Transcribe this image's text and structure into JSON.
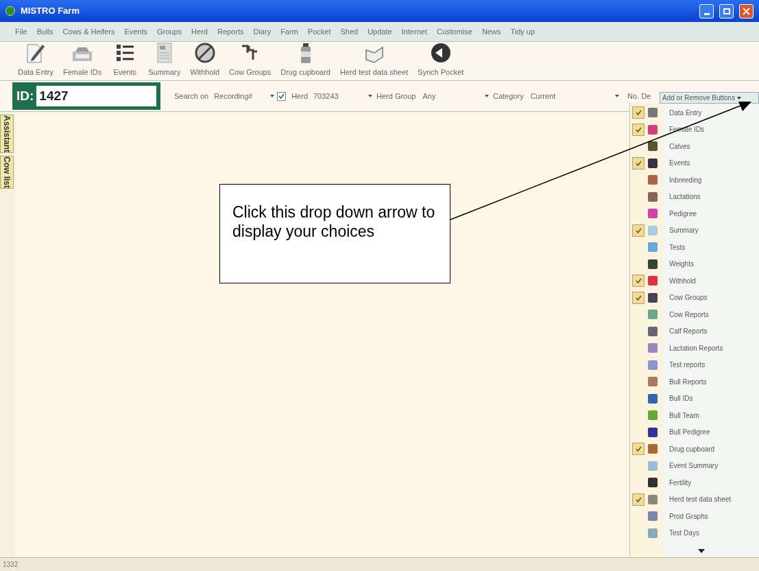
{
  "window": {
    "title": "MISTRO Farm"
  },
  "menu": [
    "File",
    "Bulls",
    "Cows & Heifers",
    "Events",
    "Groups",
    "Herd",
    "Reports",
    "Diary",
    "Farm",
    "Pocket",
    "Shed",
    "Update",
    "Internet",
    "Customise",
    "News",
    "Tidy up"
  ],
  "toolbar": [
    "Data Entry",
    "Female IDs",
    "Events",
    "Summary",
    "Withhold",
    "Cow Groups",
    "Drug cupboard",
    "Herd test data sheet",
    "Synch Pocket"
  ],
  "search_bar": {
    "id_label": "ID:",
    "id_value": "1427",
    "search_on_label": "Search on",
    "search_on_value": "Recording#",
    "herd_checked": true,
    "herd_label": "Herd",
    "herd_value": "703243",
    "herd_group_label": "Herd Group",
    "herd_group_value": "Any",
    "category_label": "Category",
    "category_value": "Current",
    "column_cut": "No. De"
  },
  "side_tabs": [
    "Assistant",
    "Cow list"
  ],
  "add_remove_menu": {
    "title": "Add or Remove Buttons",
    "items": [
      {
        "label": "Data Entry",
        "checked": true
      },
      {
        "label": "Female IDs",
        "checked": true
      },
      {
        "label": "Calves",
        "checked": false
      },
      {
        "label": "Events",
        "checked": true
      },
      {
        "label": "Inbreeding",
        "checked": false
      },
      {
        "label": "Lactations",
        "checked": false
      },
      {
        "label": "Pedigree",
        "checked": false
      },
      {
        "label": "Summary",
        "checked": true
      },
      {
        "label": "Tests",
        "checked": false
      },
      {
        "label": "Weights",
        "checked": false
      },
      {
        "label": "Withhold",
        "checked": true
      },
      {
        "label": "Cow Groups",
        "checked": true
      },
      {
        "label": "Cow Reports",
        "checked": false
      },
      {
        "label": "Calf Reports",
        "checked": false
      },
      {
        "label": "Lactation Reports",
        "checked": false
      },
      {
        "label": "Test reports",
        "checked": false
      },
      {
        "label": "Bull Reports",
        "checked": false
      },
      {
        "label": "Bull IDs",
        "checked": false
      },
      {
        "label": "Bull Team",
        "checked": false
      },
      {
        "label": "Bull Pedigree",
        "checked": false
      },
      {
        "label": "Drug cupboard",
        "checked": true
      },
      {
        "label": "Event Summary",
        "checked": false
      },
      {
        "label": "Fertility",
        "checked": false
      },
      {
        "label": "Herd test data sheet",
        "checked": true
      },
      {
        "label": "Prod Graphs",
        "checked": false
      },
      {
        "label": "Test Days",
        "checked": false
      }
    ]
  },
  "callout": {
    "text": "Click this drop down arrow to display your choices"
  },
  "status_bar": {
    "text": "1332"
  }
}
